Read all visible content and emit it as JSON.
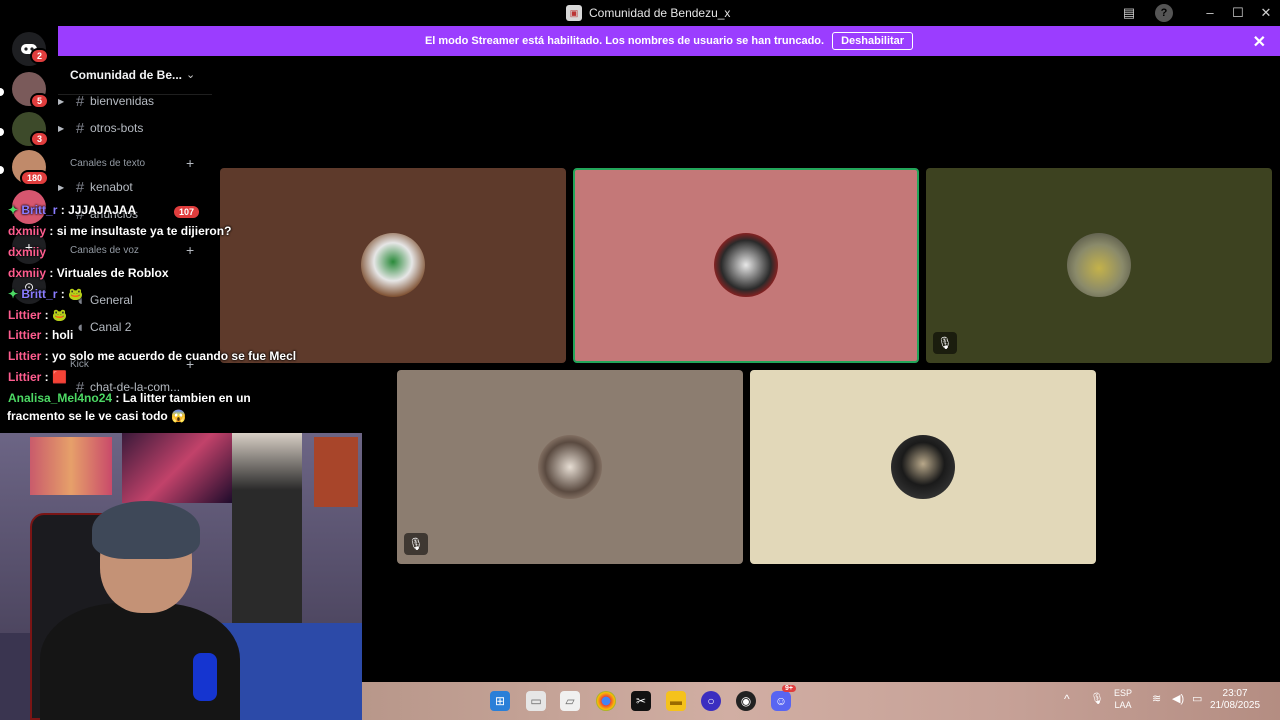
{
  "window": {
    "title": "Comunidad de Bendezu_x",
    "app_icon": "discord-app-icon"
  },
  "banner": {
    "text": "El modo Streamer está habilitado. Los nombres de usuario se han truncado.",
    "button_label": "Deshabilitar",
    "close_icon": "close-icon",
    "color": "#9b3dff"
  },
  "rail": {
    "home_badge": "2",
    "servers": [
      {
        "badge": "5",
        "color": "#7a5a5a"
      },
      {
        "badge": "3",
        "color": "#3d4a2a"
      },
      {
        "badge": "180",
        "color": "#c08a6a"
      },
      {
        "badge": "",
        "color": "#d6566f"
      }
    ]
  },
  "sidebar": {
    "server_name": "Comunidad de Be...",
    "channels_top": [
      {
        "label": "bienvenidas"
      },
      {
        "label": "otros-bots"
      }
    ],
    "category_text": "Canales de texto",
    "text_channels": [
      {
        "label": "kenabot"
      },
      {
        "label": "anuncios",
        "badge": "107"
      }
    ],
    "category_voice": "Canales de voz",
    "voice_channels": [
      {
        "label": "General"
      },
      {
        "label": "Canal 2"
      }
    ],
    "category_kick": "Kick",
    "kick_channels": [
      {
        "label": "chat-de-la-com..."
      }
    ]
  },
  "grid": {
    "tiles": [
      {
        "color": "#5e3a2b",
        "speaking": false,
        "muted": false
      },
      {
        "color": "#c47878",
        "speaking": true,
        "muted": false
      },
      {
        "color": "#3d4220",
        "speaking": false,
        "muted": true
      },
      {
        "color": "#8c7d70",
        "speaking": false,
        "muted": true
      },
      {
        "color": "#e2d8b9",
        "speaking": false,
        "muted": false
      }
    ]
  },
  "chat": {
    "lines": [
      {
        "user": "Britt_r",
        "sep": " : ",
        "msg": "JJJAJAJAA",
        "color": "#8a7cff",
        "badge": true
      },
      {
        "user": "dxmiiy",
        "sep": " : ",
        "msg": "si me insultaste ya te dijieron?",
        "color": "#ff5d8f",
        "badge": false
      },
      {
        "user": "dxmiiy",
        "sep": "",
        "msg": "",
        "color": "#ff5d8f",
        "badge": false
      },
      {
        "user": "dxmiiy",
        "sep": " : ",
        "msg": "Virtuales de Roblox",
        "color": "#ff5d8f",
        "badge": false
      },
      {
        "user": "Britt_r",
        "sep": " : ",
        "msg": "",
        "color": "#8a7cff",
        "badge": true
      },
      {
        "user": "Littier",
        "sep": " : ",
        "msg": "",
        "color": "#ff5d8f",
        "badge": false
      },
      {
        "user": "Littier",
        "sep": " : ",
        "msg": "holi",
        "color": "#ff5d8f",
        "badge": false
      },
      {
        "user": "Littier",
        "sep": " : ",
        "msg": "yo solo me acuerdo de cuando se fue Mecl",
        "color": "#ff5d8f",
        "badge": false
      },
      {
        "user": "Littier",
        "sep": " : ",
        "msg": "",
        "color": "#ff5d8f",
        "badge": false
      },
      {
        "user": "Analisa_Mel4no24",
        "sep": " : ",
        "msg": "La litter tambien en un",
        "color": "#4cd964",
        "badge": false
      },
      {
        "user": "",
        "sep": "",
        "msg": "fracmento se le ve casi todo",
        "color": "#fff",
        "badge": false
      }
    ]
  },
  "taskbar": {
    "apps": [
      "start-icon",
      "file-icon",
      "notes-icon",
      "chrome-icon",
      "capcut-icon",
      "explorer-icon",
      "app-icon",
      "obs-icon",
      "discord-icon"
    ],
    "discord_badge": "9+",
    "lang_top": "ESP",
    "lang_bottom": "LAA",
    "time": "23:07",
    "date": "21/08/2025"
  }
}
